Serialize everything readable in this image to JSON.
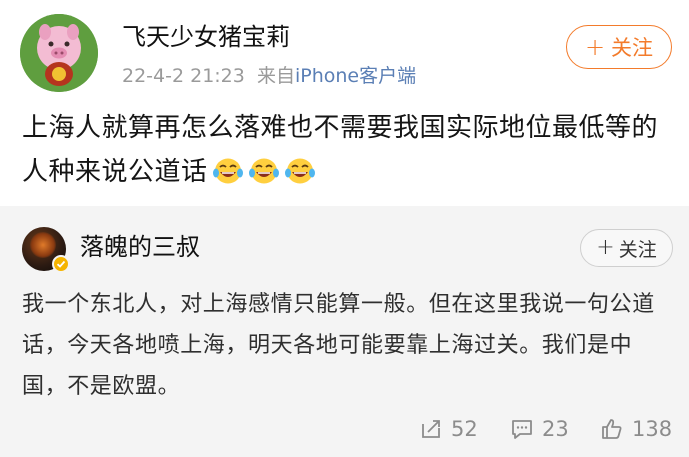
{
  "post": {
    "username": "飞天少女猪宝莉",
    "time": "22-4-2 21:23",
    "source_prefix": "来自",
    "source": "iPhone客户端",
    "follow_label": "关注",
    "text": "上海人就算再怎么落难也不需要我国实际地位最低等的人种来说公道话",
    "emojis": [
      "laugh-cry-icon",
      "laugh-cry-icon",
      "laugh-cry-icon"
    ]
  },
  "comment": {
    "username": "落魄的三叔",
    "follow_label": "关注",
    "text": "我一个东北人，对上海感情只能算一般。但在这里我说一句公道话，今天各地喷上海，明天各地可能要靠上海过关。我们是中国，不是欧盟。",
    "stats": {
      "retweets": "52",
      "comments": "23",
      "likes": "138"
    }
  },
  "colors": {
    "accent": "#f37b2b",
    "link": "#5b7fb5",
    "meta": "#9a9a9a",
    "card_bg": "#f4f4f4",
    "verified": "#f5b400"
  }
}
